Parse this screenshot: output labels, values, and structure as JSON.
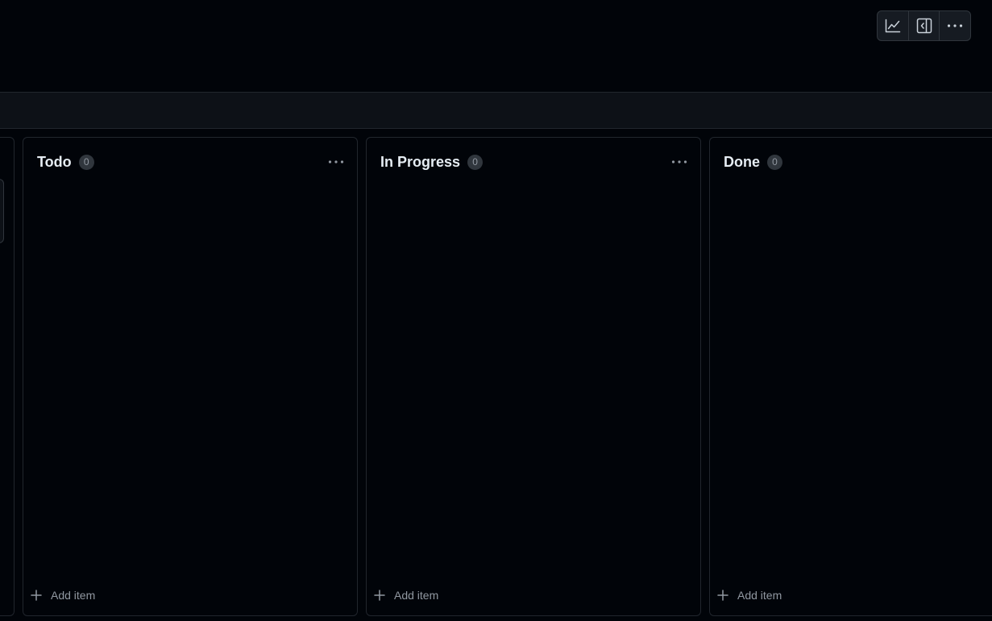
{
  "toolbar": {
    "buttons": [
      {
        "icon": "graph-icon"
      },
      {
        "icon": "sidebar-panel-icon"
      },
      {
        "icon": "kebab-horizontal-icon"
      }
    ]
  },
  "board": {
    "columns": [
      {
        "title": "Todo",
        "count": "0",
        "add_label": "Add item"
      },
      {
        "title": "In Progress",
        "count": "0",
        "add_label": "Add item"
      },
      {
        "title": "Done",
        "count": "0",
        "add_label": "Add item"
      }
    ]
  },
  "colors": {
    "background": "#010409",
    "border": "#21262d",
    "text": "#e6edf3",
    "muted": "#9198a1",
    "counter_bg": "#30363d"
  }
}
